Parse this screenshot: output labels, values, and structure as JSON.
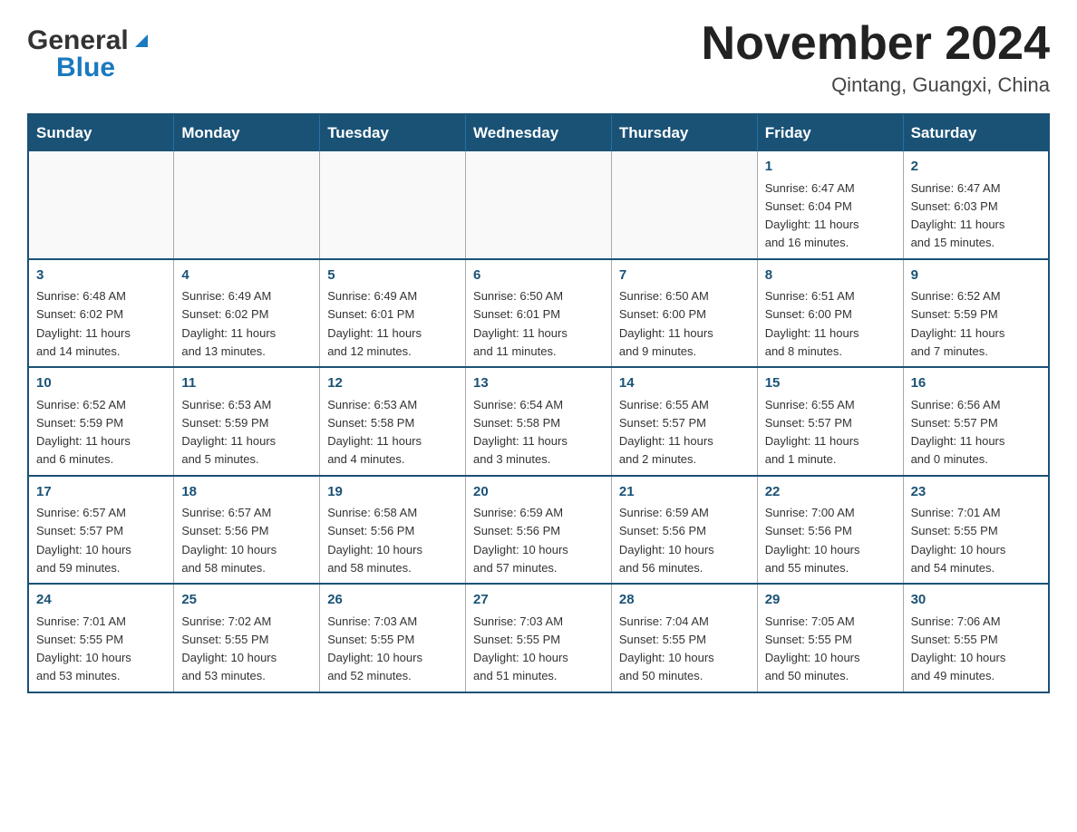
{
  "header": {
    "logo": {
      "general": "General",
      "blue": "Blue"
    },
    "title": "November 2024",
    "location": "Qintang, Guangxi, China"
  },
  "calendar": {
    "days_of_week": [
      "Sunday",
      "Monday",
      "Tuesday",
      "Wednesday",
      "Thursday",
      "Friday",
      "Saturday"
    ],
    "weeks": [
      [
        {
          "day": "",
          "info": ""
        },
        {
          "day": "",
          "info": ""
        },
        {
          "day": "",
          "info": ""
        },
        {
          "day": "",
          "info": ""
        },
        {
          "day": "",
          "info": ""
        },
        {
          "day": "1",
          "info": "Sunrise: 6:47 AM\nSunset: 6:04 PM\nDaylight: 11 hours\nand 16 minutes."
        },
        {
          "day": "2",
          "info": "Sunrise: 6:47 AM\nSunset: 6:03 PM\nDaylight: 11 hours\nand 15 minutes."
        }
      ],
      [
        {
          "day": "3",
          "info": "Sunrise: 6:48 AM\nSunset: 6:02 PM\nDaylight: 11 hours\nand 14 minutes."
        },
        {
          "day": "4",
          "info": "Sunrise: 6:49 AM\nSunset: 6:02 PM\nDaylight: 11 hours\nand 13 minutes."
        },
        {
          "day": "5",
          "info": "Sunrise: 6:49 AM\nSunset: 6:01 PM\nDaylight: 11 hours\nand 12 minutes."
        },
        {
          "day": "6",
          "info": "Sunrise: 6:50 AM\nSunset: 6:01 PM\nDaylight: 11 hours\nand 11 minutes."
        },
        {
          "day": "7",
          "info": "Sunrise: 6:50 AM\nSunset: 6:00 PM\nDaylight: 11 hours\nand 9 minutes."
        },
        {
          "day": "8",
          "info": "Sunrise: 6:51 AM\nSunset: 6:00 PM\nDaylight: 11 hours\nand 8 minutes."
        },
        {
          "day": "9",
          "info": "Sunrise: 6:52 AM\nSunset: 5:59 PM\nDaylight: 11 hours\nand 7 minutes."
        }
      ],
      [
        {
          "day": "10",
          "info": "Sunrise: 6:52 AM\nSunset: 5:59 PM\nDaylight: 11 hours\nand 6 minutes."
        },
        {
          "day": "11",
          "info": "Sunrise: 6:53 AM\nSunset: 5:59 PM\nDaylight: 11 hours\nand 5 minutes."
        },
        {
          "day": "12",
          "info": "Sunrise: 6:53 AM\nSunset: 5:58 PM\nDaylight: 11 hours\nand 4 minutes."
        },
        {
          "day": "13",
          "info": "Sunrise: 6:54 AM\nSunset: 5:58 PM\nDaylight: 11 hours\nand 3 minutes."
        },
        {
          "day": "14",
          "info": "Sunrise: 6:55 AM\nSunset: 5:57 PM\nDaylight: 11 hours\nand 2 minutes."
        },
        {
          "day": "15",
          "info": "Sunrise: 6:55 AM\nSunset: 5:57 PM\nDaylight: 11 hours\nand 1 minute."
        },
        {
          "day": "16",
          "info": "Sunrise: 6:56 AM\nSunset: 5:57 PM\nDaylight: 11 hours\nand 0 minutes."
        }
      ],
      [
        {
          "day": "17",
          "info": "Sunrise: 6:57 AM\nSunset: 5:57 PM\nDaylight: 10 hours\nand 59 minutes."
        },
        {
          "day": "18",
          "info": "Sunrise: 6:57 AM\nSunset: 5:56 PM\nDaylight: 10 hours\nand 58 minutes."
        },
        {
          "day": "19",
          "info": "Sunrise: 6:58 AM\nSunset: 5:56 PM\nDaylight: 10 hours\nand 58 minutes."
        },
        {
          "day": "20",
          "info": "Sunrise: 6:59 AM\nSunset: 5:56 PM\nDaylight: 10 hours\nand 57 minutes."
        },
        {
          "day": "21",
          "info": "Sunrise: 6:59 AM\nSunset: 5:56 PM\nDaylight: 10 hours\nand 56 minutes."
        },
        {
          "day": "22",
          "info": "Sunrise: 7:00 AM\nSunset: 5:56 PM\nDaylight: 10 hours\nand 55 minutes."
        },
        {
          "day": "23",
          "info": "Sunrise: 7:01 AM\nSunset: 5:55 PM\nDaylight: 10 hours\nand 54 minutes."
        }
      ],
      [
        {
          "day": "24",
          "info": "Sunrise: 7:01 AM\nSunset: 5:55 PM\nDaylight: 10 hours\nand 53 minutes."
        },
        {
          "day": "25",
          "info": "Sunrise: 7:02 AM\nSunset: 5:55 PM\nDaylight: 10 hours\nand 53 minutes."
        },
        {
          "day": "26",
          "info": "Sunrise: 7:03 AM\nSunset: 5:55 PM\nDaylight: 10 hours\nand 52 minutes."
        },
        {
          "day": "27",
          "info": "Sunrise: 7:03 AM\nSunset: 5:55 PM\nDaylight: 10 hours\nand 51 minutes."
        },
        {
          "day": "28",
          "info": "Sunrise: 7:04 AM\nSunset: 5:55 PM\nDaylight: 10 hours\nand 50 minutes."
        },
        {
          "day": "29",
          "info": "Sunrise: 7:05 AM\nSunset: 5:55 PM\nDaylight: 10 hours\nand 50 minutes."
        },
        {
          "day": "30",
          "info": "Sunrise: 7:06 AM\nSunset: 5:55 PM\nDaylight: 10 hours\nand 49 minutes."
        }
      ]
    ]
  }
}
